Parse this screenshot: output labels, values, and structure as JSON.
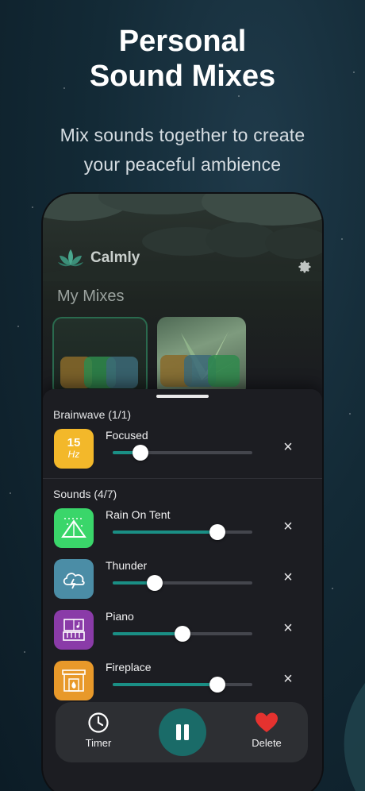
{
  "hero": {
    "title_line1": "Personal",
    "title_line2": "Sound Mixes",
    "subtitle_line1": "Mix sounds together to create",
    "subtitle_line2": "your peaceful ambience"
  },
  "app": {
    "brand_name": "Calmly",
    "section_title": "My Mixes",
    "settings_icon": "gear-icon"
  },
  "sheet": {
    "brainwave_label": "Brainwave (1/1)",
    "sounds_label": "Sounds (4/7)",
    "brainwave": {
      "name": "Focused",
      "icon_text_top": "15",
      "icon_text_bottom": "Hz",
      "color": "#f3b82a",
      "level": 0.2
    },
    "sounds": [
      {
        "name": "Rain On Tent",
        "icon": "tent-icon",
        "color": "#3ad66a",
        "level": 0.75
      },
      {
        "name": "Thunder",
        "icon": "thunder-cloud-icon",
        "color": "#4b8da6",
        "level": 0.3
      },
      {
        "name": "Piano",
        "icon": "piano-icon",
        "color": "#8a3ba8",
        "level": 0.5
      },
      {
        "name": "Fireplace",
        "icon": "fireplace-icon",
        "color": "#e8992a",
        "level": 0.75
      }
    ],
    "remove_symbol": "×"
  },
  "controls": {
    "timer_label": "Timer",
    "delete_label": "Delete",
    "accent": "#1a6b68",
    "heart_color": "#e5322f"
  }
}
